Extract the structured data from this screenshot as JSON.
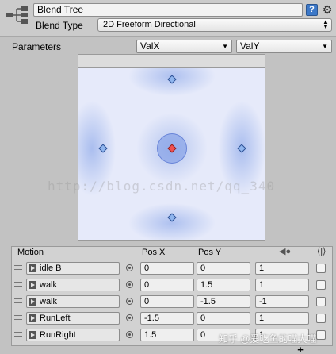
{
  "header": {
    "name": "Blend Tree",
    "help_icon": "help-icon",
    "help_glyph": "?",
    "gear_icon": "gear-icon",
    "gear_glyph": "⚙",
    "blend_type_label": "Blend Type",
    "blend_type_value": "2D Freeform Directional"
  },
  "parameters": {
    "label": "Parameters",
    "x_param": "ValX",
    "y_param": "ValY"
  },
  "blend_space": {
    "watermark": "http://blog.csdn.net/qq_340"
  },
  "motion_table": {
    "headers": {
      "motion": "Motion",
      "pos_x": "Pos X",
      "pos_y": "Pos Y"
    },
    "timescale_glyph": "◀●",
    "mirror_glyph": "⟨|⟩",
    "rows": [
      {
        "clip": "idle B",
        "pos_x": "0",
        "pos_y": "0",
        "speed": "1",
        "mirror": false
      },
      {
        "clip": "walk",
        "pos_x": "0",
        "pos_y": "1.5",
        "speed": "1",
        "mirror": false
      },
      {
        "clip": "walk",
        "pos_x": "0",
        "pos_y": "-1.5",
        "speed": "-1",
        "mirror": false
      },
      {
        "clip": "RunLeft",
        "pos_x": "-1.5",
        "pos_y": "0",
        "speed": "1",
        "mirror": false
      },
      {
        "clip": "RunRight",
        "pos_x": "1.5",
        "pos_y": "0",
        "speed": "1",
        "mirror": false
      }
    ],
    "add_label": "+"
  },
  "footer_watermark": "知乎 @爱吃鱼的喵大喵",
  "colors": {
    "node": "#8fb5ee",
    "active_node": "#f05050",
    "blend_background": "#e6eafa"
  }
}
